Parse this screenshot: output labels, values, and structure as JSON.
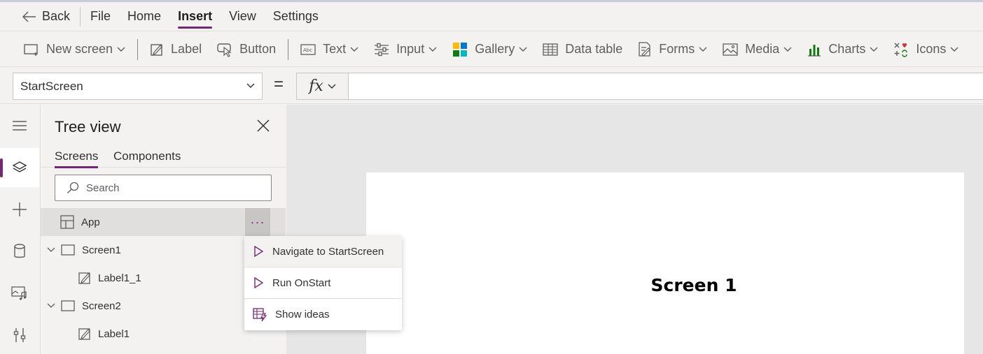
{
  "menubar": {
    "back_label": "Back",
    "items": [
      "File",
      "Home",
      "Insert",
      "View",
      "Settings"
    ],
    "active": "Insert"
  },
  "ribbon": {
    "new_screen": "New screen",
    "label": "Label",
    "button": "Button",
    "text": "Text",
    "input": "Input",
    "gallery": "Gallery",
    "data_table": "Data table",
    "forms": "Forms",
    "media": "Media",
    "charts": "Charts",
    "icons": "Icons"
  },
  "formula_bar": {
    "property_value": "StartScreen",
    "equals": "=",
    "fx_label": "fx",
    "formula": ""
  },
  "tree_view": {
    "title": "Tree view",
    "tabs": [
      "Screens",
      "Components"
    ],
    "active_tab": "Screens",
    "search_placeholder": "Search",
    "nodes": [
      {
        "label": "App",
        "icon": "app-icon"
      },
      {
        "label": "Screen1",
        "icon": "screen-icon"
      },
      {
        "label": "Label1_1",
        "icon": "label-icon"
      },
      {
        "label": "Screen2",
        "icon": "screen-icon"
      },
      {
        "label": "Label1",
        "icon": "label-icon"
      }
    ],
    "more_label": "···"
  },
  "context_menu": {
    "items": [
      {
        "label": "Navigate to StartScreen",
        "icon": "play-icon"
      },
      {
        "label": "Run OnStart",
        "icon": "play-icon"
      },
      {
        "label": "Show ideas",
        "icon": "ideas-icon"
      }
    ]
  },
  "canvas": {
    "screen_text": "Screen 1"
  },
  "colors": {
    "accent": "#742774",
    "background": "#f3f2f1",
    "canvas": "#e6e6e6"
  }
}
